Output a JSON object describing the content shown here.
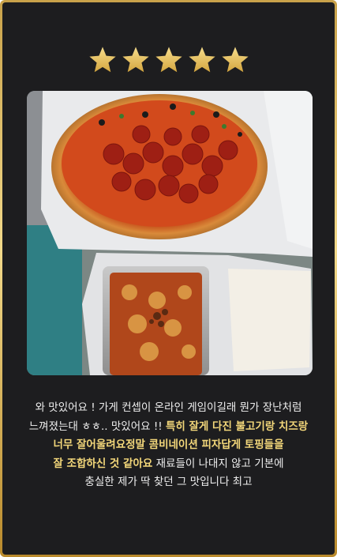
{
  "rating": {
    "stars": 5,
    "max": 5,
    "color": "#f1cc6a"
  },
  "photo": {
    "subject": "pizza with pepperoni and a side tray of baked cheese pasta"
  },
  "review": {
    "line1": "와 맛있어요 ! 가게 컨셉이 온라인 게임이길래 뭔가 장난처럼",
    "line2_plain": "느껴졌는대 ㅎㅎ.. 맛있어요 !! ",
    "line2_highlight": "특히 잘게 다진 불고기랑 치즈랑",
    "line3_highlight": "너무 잘어울려요정말 콤비네이션 피자답게 토핑들을",
    "line4_highlight": "잘 조합하신 것 같아요",
    "line4_plain": " 재료들이 나대지 않고 기본에",
    "line5": "충실한 제가 딱 찾던 그 맛입니다 최고"
  },
  "colors": {
    "background": "#1d1d1f",
    "border_gold": "#d9b45a",
    "highlight": "#f3d77a",
    "text": "#eeeeee"
  }
}
